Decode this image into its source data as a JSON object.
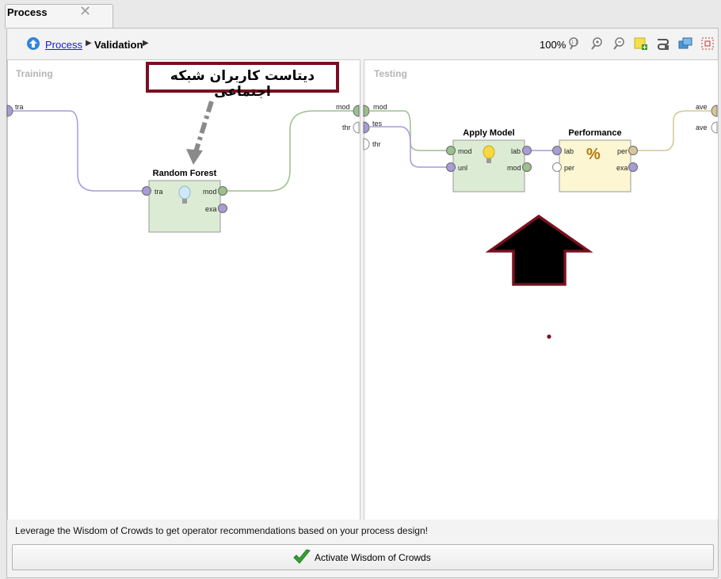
{
  "tab": {
    "title": "Process",
    "close_glyph": "✕"
  },
  "breadcrumb": {
    "process": "Process",
    "current": "Validation",
    "separator": "▶"
  },
  "toolbar": {
    "zoom": "100%",
    "tools": [
      "zoom-fit-icon",
      "zoom-in-icon",
      "zoom-out-icon",
      "add-note-icon",
      "auto-wire-icon",
      "arrange-icon",
      "select-all-icon"
    ]
  },
  "training": {
    "label": "Training",
    "left_port": "tra",
    "right_ports": [
      "mod"
    ]
  },
  "testing": {
    "label": "Testing",
    "left_ports": [
      "mod",
      "thr",
      "tes",
      "thr"
    ],
    "right_ports": [
      "ave",
      "ave"
    ]
  },
  "operators": {
    "random_forest": {
      "title": "Random Forest",
      "in": [
        "tra"
      ],
      "out": [
        "mod",
        "exa"
      ],
      "icon": "lightbulb-icon"
    },
    "apply_model": {
      "title": "Apply Model",
      "in": [
        "mod",
        "unl"
      ],
      "out": [
        "lab",
        "mod"
      ],
      "icon": "lightbulb-icon"
    },
    "performance": {
      "title": "Performance",
      "in": [
        "lab",
        "per"
      ],
      "out": [
        "per",
        "exa"
      ],
      "icon": "percent-icon",
      "glyph": "%"
    }
  },
  "annotation": {
    "text": "دیتاست کاربران شبکه اجتماعی"
  },
  "status": {
    "message": "Leverage the Wisdom of Crowds to get operator recommendations based on your process design!"
  },
  "wisdom_button": {
    "label": "Activate Wisdom of Crowds",
    "icon": "checkmark-icon"
  },
  "colors": {
    "annotation_border": "#7a0f1f",
    "port_purple": "#a69cd6",
    "port_green": "#9cbf8d",
    "op_green": "#dcecd4",
    "op_yellow": "#fdf6d3"
  }
}
